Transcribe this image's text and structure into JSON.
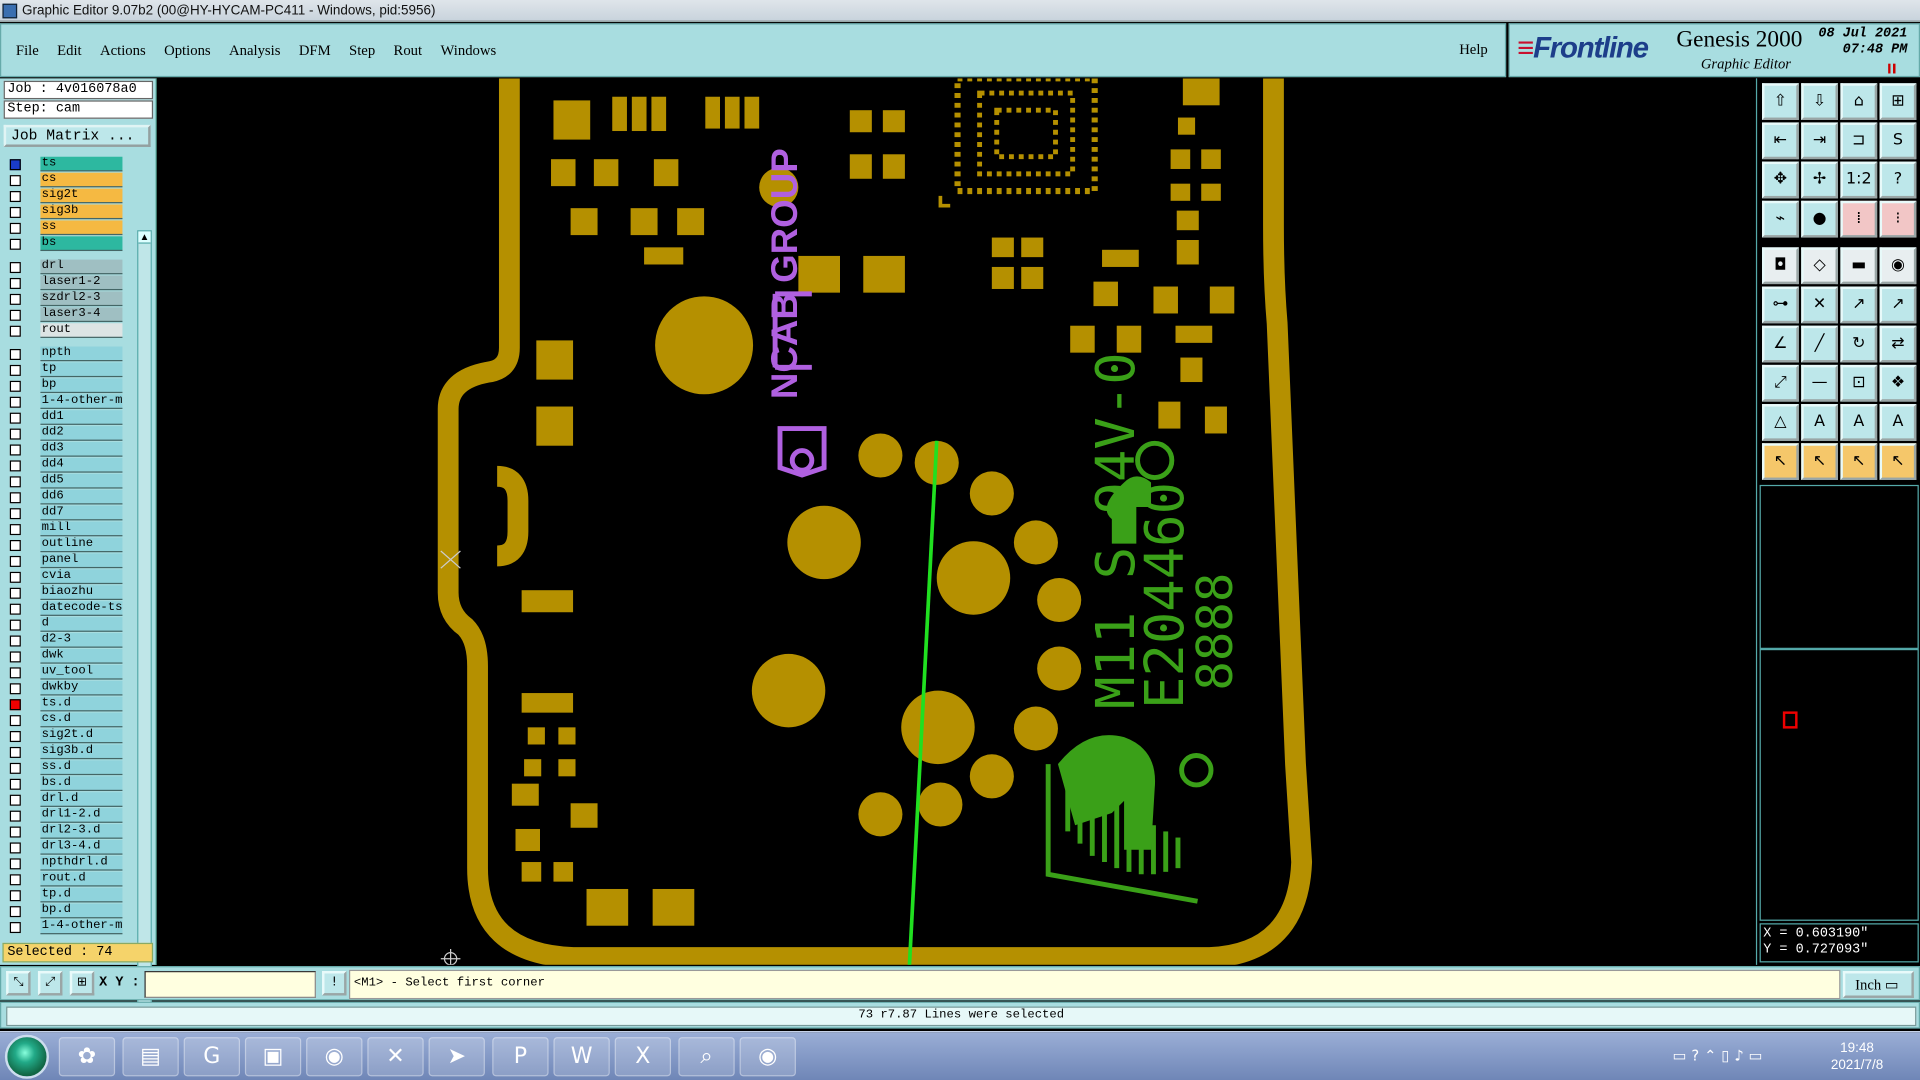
{
  "window": {
    "title": "Graphic Editor 9.07b2 (00@HY-HYCAM-PC411 - Windows, pid:5956)"
  },
  "menu": {
    "items": [
      "File",
      "Edit",
      "Actions",
      "Options",
      "Analysis",
      "DFM",
      "Step",
      "Rout",
      "Windows"
    ],
    "help": "Help"
  },
  "brand": {
    "logo": "Frontline",
    "product": "Genesis 2000",
    "subtitle": "Graphic Editor",
    "date": "08 Jul 2021",
    "time": "07:48 PM"
  },
  "job": {
    "job_label": "Job : 4v016078a0",
    "step_label": "Step: cam",
    "job_matrix": "Job Matrix ...",
    "selected": "Selected : 74"
  },
  "layers": [
    {
      "name": "ts",
      "color": "#2db8a0",
      "check": "blue"
    },
    {
      "name": "cs",
      "color": "#f5b942"
    },
    {
      "name": "sig2t",
      "color": "#f5b942"
    },
    {
      "name": "sig3b",
      "color": "#f5b942"
    },
    {
      "name": "ss",
      "color": "#f5b942"
    },
    {
      "name": "bs",
      "color": "#2db8a0"
    },
    {
      "name": "drl",
      "color": "#9fbfc2"
    },
    {
      "name": "laser1-2",
      "color": "#9fbfc2"
    },
    {
      "name": "szdrl2-3",
      "color": "#9fbfc2"
    },
    {
      "name": "laser3-4",
      "color": "#9fbfc2"
    },
    {
      "name": "rout",
      "color": "#dde4e4"
    },
    {
      "name": "npth",
      "color": "#8fd3dc"
    },
    {
      "name": "tp",
      "color": "#8fd3dc"
    },
    {
      "name": "bp",
      "color": "#8fd3dc"
    },
    {
      "name": "1-4-other-m",
      "color": "#8fd3dc"
    },
    {
      "name": "dd1",
      "color": "#8fd3dc"
    },
    {
      "name": "dd2",
      "color": "#8fd3dc"
    },
    {
      "name": "dd3",
      "color": "#8fd3dc"
    },
    {
      "name": "dd4",
      "color": "#8fd3dc"
    },
    {
      "name": "dd5",
      "color": "#8fd3dc"
    },
    {
      "name": "dd6",
      "color": "#8fd3dc"
    },
    {
      "name": "dd7",
      "color": "#8fd3dc"
    },
    {
      "name": "mill",
      "color": "#8fd3dc"
    },
    {
      "name": "outline",
      "color": "#8fd3dc"
    },
    {
      "name": "panel",
      "color": "#8fd3dc"
    },
    {
      "name": "cvia",
      "color": "#8fd3dc"
    },
    {
      "name": "biaozhu",
      "color": "#8fd3dc"
    },
    {
      "name": "datecode-ts",
      "color": "#8fd3dc"
    },
    {
      "name": "d",
      "color": "#8fd3dc"
    },
    {
      "name": "d2-3",
      "color": "#8fd3dc"
    },
    {
      "name": "dwk",
      "color": "#8fd3dc"
    },
    {
      "name": "uv_tool",
      "color": "#8fd3dc"
    },
    {
      "name": "dwkby",
      "color": "#8fd3dc"
    },
    {
      "name": "ts.d",
      "color": "#8fd3dc",
      "check": "red"
    },
    {
      "name": "cs.d",
      "color": "#8fd3dc"
    },
    {
      "name": "sig2t.d",
      "color": "#8fd3dc"
    },
    {
      "name": "sig3b.d",
      "color": "#8fd3dc"
    },
    {
      "name": "ss.d",
      "color": "#8fd3dc"
    },
    {
      "name": "bs.d",
      "color": "#8fd3dc"
    },
    {
      "name": "drl.d",
      "color": "#8fd3dc"
    },
    {
      "name": "drl1-2.d",
      "color": "#8fd3dc"
    },
    {
      "name": "drl2-3.d",
      "color": "#8fd3dc"
    },
    {
      "name": "drl3-4.d",
      "color": "#8fd3dc"
    },
    {
      "name": "npthdrl.d",
      "color": "#8fd3dc"
    },
    {
      "name": "rout.d",
      "color": "#8fd3dc"
    },
    {
      "name": "tp.d",
      "color": "#8fd3dc"
    },
    {
      "name": "bp.d",
      "color": "#8fd3dc"
    },
    {
      "name": "1-4-other-m",
      "color": "#8fd3dc"
    }
  ],
  "canvas": {
    "pcb_text_1": "M11 S 94V-0",
    "pcb_text_2": "E204460",
    "pcb_text_3": "8888",
    "logo_text": "NCAB GROUP",
    "colors": {
      "copper": "#b59000",
      "silk": "#3aa018",
      "logo": "#b060e0",
      "selection": "#20e020"
    }
  },
  "coords": {
    "x": "X = 0.603190\"",
    "y": "Y = 0.727093\""
  },
  "input": {
    "xy_label": "X Y :",
    "value": ""
  },
  "prompt": "<M1> - Select first corner",
  "unit": "Inch",
  "status": "73 r7.87 Lines were selected",
  "taskbar": {
    "time": "19:48",
    "date": "2021/7/8"
  }
}
